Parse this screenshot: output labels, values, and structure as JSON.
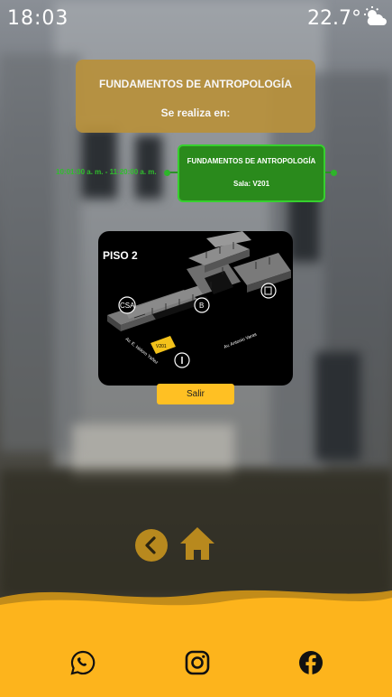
{
  "status_bar": {
    "time": "18:03",
    "temperature": "22.7°",
    "weather_icon": "partly-cloudy-icon"
  },
  "header": {
    "course_title": "FUNDAMENTOS DE ANTROPOLOGÍA",
    "subtitle": "Se realiza en:"
  },
  "schedule": {
    "time_range": "10:01:00 a. m. - 11:20:00 a. m.",
    "course_title": "FUNDAMENTOS DE ANTROPOLOGÍA",
    "room": "Sala: V201"
  },
  "map": {
    "floor_label": "PISO 2",
    "marker_csa": "CSA",
    "marker_b": "B",
    "street_left": "Av. E. Isidoro Yañez",
    "street_right": "Av. Antonio Varas",
    "highlighted_room": "V201"
  },
  "actions": {
    "exit_label": "Salir"
  },
  "footer": {
    "icons": [
      "whatsapp-icon",
      "instagram-icon",
      "facebook-icon"
    ]
  },
  "colors": {
    "accent_gold": "#b8913c",
    "active_green": "#2a8a1c",
    "footer_yellow": "#fdb41c"
  }
}
